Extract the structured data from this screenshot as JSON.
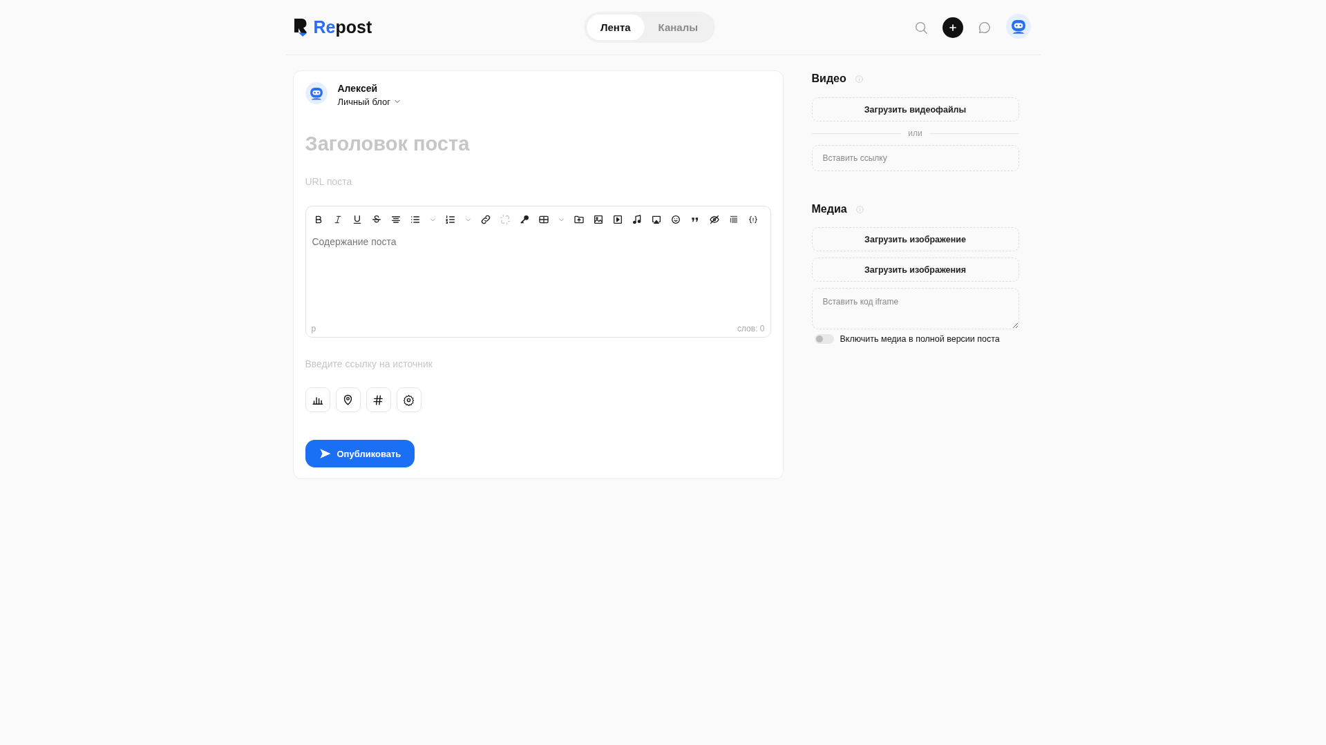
{
  "header": {
    "logo": {
      "part_1": "Re",
      "part_2": "post"
    },
    "tabs": [
      {
        "label": "Лента",
        "selected": true
      },
      {
        "label": "Каналы",
        "selected": false
      }
    ]
  },
  "editor": {
    "author": {
      "name": "Алексей",
      "blog": "Личный блог"
    },
    "title": {
      "placeholder": "Заголовок поста"
    },
    "url": {
      "placeholder": "URL поста"
    },
    "toolbar": [
      {
        "kind": "bold",
        "disabled": false
      },
      {
        "kind": "italic",
        "disabled": false
      },
      {
        "kind": "underline",
        "disabled": false
      },
      {
        "kind": "strike",
        "disabled": false
      },
      {
        "kind": "align",
        "disabled": false
      },
      {
        "kind": "bullets",
        "disabled": false,
        "dropdown": true
      },
      {
        "kind": "numbers",
        "disabled": false,
        "dropdown": true
      },
      {
        "kind": "link",
        "disabled": false
      },
      {
        "kind": "unlink",
        "disabled": true
      },
      {
        "kind": "key",
        "disabled": false
      },
      {
        "kind": "table",
        "disabled": false,
        "dropdown": true
      },
      {
        "kind": "upload",
        "disabled": false
      },
      {
        "kind": "image",
        "disabled": false
      },
      {
        "kind": "video",
        "disabled": false
      },
      {
        "kind": "music",
        "disabled": false
      },
      {
        "kind": "cast",
        "disabled": false
      },
      {
        "kind": "emoji",
        "disabled": false
      },
      {
        "kind": "quote",
        "disabled": false
      },
      {
        "kind": "hidden",
        "disabled": false
      },
      {
        "kind": "lines",
        "disabled": false
      },
      {
        "kind": "code",
        "disabled": false
      }
    ],
    "content": {
      "placeholder": "Содержание поста"
    },
    "status": {
      "element": "p",
      "words": "слов: 0"
    },
    "source": {
      "placeholder": "Введите ссылку на источник"
    },
    "actions": [
      {
        "kind": "poll"
      },
      {
        "kind": "location"
      },
      {
        "kind": "hashtag"
      },
      {
        "kind": "settings"
      }
    ],
    "publish": "Опубликовать"
  },
  "video": {
    "title": "Видео",
    "upload": "Загрузить видеофайлы",
    "or": "или",
    "link": {
      "placeholder": "Вставить ссылку"
    }
  },
  "media": {
    "title": "Медиа",
    "buttons": [
      "Загрузить изображение",
      "Загрузить изображения"
    ],
    "iframe": {
      "placeholder": "Вставить код iframe"
    },
    "toggle": {
      "label": "Включить медиа в полной версии поста",
      "on": false
    }
  }
}
